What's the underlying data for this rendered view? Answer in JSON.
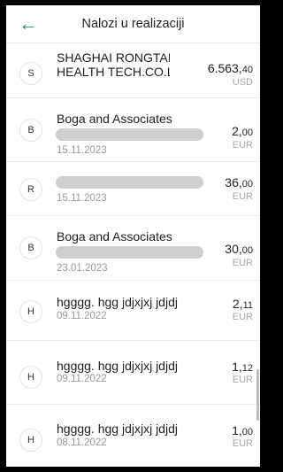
{
  "header": {
    "title": "Nalozi u realizaciji",
    "back_icon": "arrow-left-icon"
  },
  "colors": {
    "accent": "#1a8a84"
  },
  "orders": [
    {
      "initial": "S",
      "name_line1": "SHAGHAI RONGTAI",
      "name_line2": "HEALTH TECH.CO.LT...",
      "date": "",
      "amount_int": "6.563,",
      "amount_dec": "40",
      "currency": "USD"
    },
    {
      "initial": "B",
      "name_line1": "Boga and Associates",
      "name_line2": "",
      "date": "15.11.2023",
      "amount_int": "2,",
      "amount_dec": "00",
      "currency": "EUR"
    },
    {
      "initial": "R",
      "name_line1": "",
      "name_line2": "",
      "date": "15.11.2023",
      "amount_int": "36,",
      "amount_dec": "00",
      "currency": "EUR"
    },
    {
      "initial": "B",
      "name_line1": "Boga and Associates",
      "name_line2": "",
      "date": "23.01.2023",
      "amount_int": "30,",
      "amount_dec": "00",
      "currency": "EUR"
    },
    {
      "initial": "H",
      "name_line1": "hgggg. hgg jdjxjxj jdjdj",
      "name_line2": "",
      "date": "09.11.2022",
      "amount_int": "2,",
      "amount_dec": "11",
      "currency": "EUR"
    },
    {
      "initial": "H",
      "name_line1": "hgggg. hgg jdjxjxj jdjdj",
      "name_line2": "",
      "date": "09.11.2022",
      "amount_int": "1,",
      "amount_dec": "12",
      "currency": "EUR"
    },
    {
      "initial": "H",
      "name_line1": "hgggg. hgg jdjxjxj jdjdj",
      "name_line2": "",
      "date": "08.11.2022",
      "amount_int": "1,",
      "amount_dec": "00",
      "currency": "EUR"
    }
  ]
}
